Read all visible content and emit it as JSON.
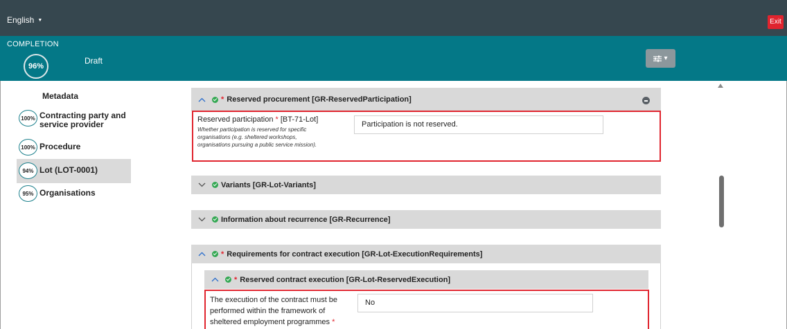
{
  "header": {
    "language": "English",
    "exit_label": "Exit"
  },
  "completion": {
    "label": "COMPLETION",
    "percent": "96%",
    "status": "Draft",
    "tools_icon": "sliders-icon"
  },
  "sidebar": {
    "title": "Metadata",
    "items": [
      {
        "percent": "100%",
        "line1": "Contracting party and",
        "line2": "service provider",
        "active": false
      },
      {
        "percent": "100%",
        "line1": "Procedure",
        "line2": "",
        "active": false
      },
      {
        "percent": "94%",
        "line1": "Lot (LOT-0001)",
        "line2": "",
        "active": true
      },
      {
        "percent": "95%",
        "line1": "Organisations",
        "line2": "",
        "active": false
      }
    ]
  },
  "groups": {
    "reserved_procurement": {
      "title": "Reserved procurement  [GR-ReservedParticipation]",
      "required": true,
      "expanded": true
    },
    "variants": {
      "title": "Variants  [GR-Lot-Variants]",
      "required": false,
      "expanded": false
    },
    "recurrence": {
      "title": "Information about recurrence  [GR-Recurrence]",
      "required": false,
      "expanded": false
    },
    "execution_requirements": {
      "title": "Requirements for contract execution  [GR-Lot-ExecutionRequirements]",
      "required": true,
      "expanded": true
    },
    "reserved_execution": {
      "title": "Reserved contract execution  [GR-Lot-ReservedExecution]",
      "required": true,
      "expanded": true
    }
  },
  "fields": {
    "reserved_participation": {
      "label": "Reserved participation",
      "code": "[BT-71-Lot]",
      "description_lines": [
        "Whether participation is reserved for specific",
        "organisations (e.g. sheltered workshops,",
        "organisations pursuing a public service mission)."
      ],
      "value": "Participation is not reserved."
    },
    "reserved_execution": {
      "label_lines": [
        "The execution of the contract must be",
        "performed within the framework of",
        "sheltered employment programmes"
      ],
      "value": "No"
    }
  },
  "colors": {
    "topbar": "#36474f",
    "completion_bar": "#047887",
    "exit_button": "#e0242e",
    "group_header": "#d9d9d9",
    "check": "#34a853",
    "required": "#e0242e"
  }
}
